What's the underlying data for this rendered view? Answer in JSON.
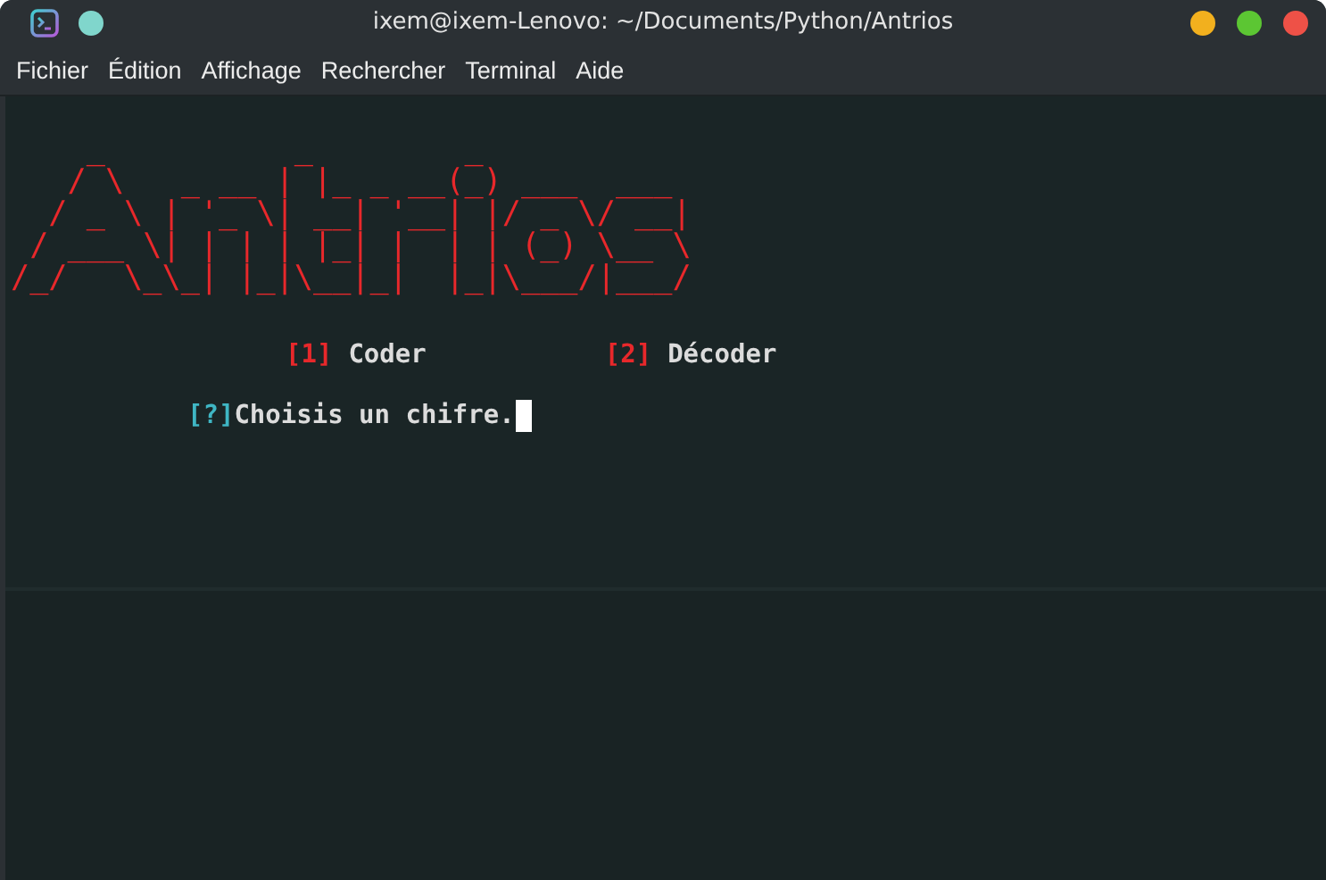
{
  "window": {
    "title": "ixem@ixem-Lenovo: ~/Documents/Python/Antrios"
  },
  "menu": [
    "Fichier",
    "Édition",
    "Affichage",
    "Rechercher",
    "Terminal",
    "Aide"
  ],
  "terminal": {
    "banner": [
      "    _          _        _           ",
      "   / \\   _ __ | |_ _ __(_) ___  ___ ",
      "  / _ \\ | '_ \\| __| '__| |/ _ \\/ __|",
      " / ___ \\| | | | |_| |  | | (_) \\__ \\",
      "/_/   \\_\\_| |_|\\__|_|  |_|\\___/|___/"
    ],
    "options": [
      {
        "key": "[1]",
        "label": "Coder"
      },
      {
        "key": "[2]",
        "label": "Décoder"
      }
    ],
    "prompt": {
      "marker": "[?]",
      "text": "Choisis un chifre."
    }
  }
}
